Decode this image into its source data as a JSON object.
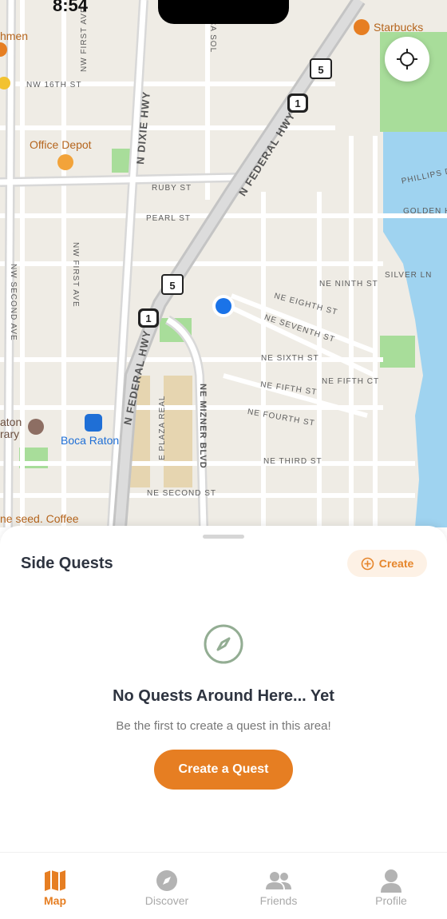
{
  "status": {
    "time": "8:54"
  },
  "map": {
    "pois": [
      {
        "name": "Starbucks"
      },
      {
        "name": "Office Depot"
      },
      {
        "name": "Boca Raton"
      },
      {
        "name": "ne seed. Coffee"
      },
      {
        "name": "hmen"
      },
      {
        "name": "aton"
      },
      {
        "name": "rary"
      }
    ],
    "streets": [
      "NW 16TH ST",
      "NW FIRST AVE",
      "N DIXIE HWY",
      "RUBY ST",
      "PEARL ST",
      "NW SECOND AVE",
      "NW FIRST AVE",
      "N FEDERAL HWY",
      "N FEDERAL HWY",
      "NE EIGHTH ST",
      "NE SEVENTH ST",
      "NE SIXTH ST",
      "NE FIFTH ST",
      "NE FIFTH CT",
      "NE FOURTH ST",
      "NE THIRD ST",
      "NE SECOND ST",
      "E PLAZA REAL",
      "NE MIZNER BLVD",
      "NE NINTH ST",
      "PHILLIPS D",
      "GOLDEN H",
      "SILVER LN",
      "CA SOL"
    ],
    "shields": [
      "5",
      "1",
      "5",
      "1"
    ],
    "colors": {
      "land": "#efece5",
      "park": "#a8dd9a",
      "water": "#9fd3f0",
      "road": "#ffffff",
      "highway": "#c9c9c9",
      "user_dot": "#1a73e8"
    }
  },
  "sheet": {
    "title": "Side Quests",
    "create_label": "Create",
    "empty_title": "No Quests Around Here... Yet",
    "empty_subtitle": "Be the first to create a quest in this area!",
    "cta_label": "Create a Quest",
    "accent": "#e67e22"
  },
  "tabs": [
    {
      "label": "Map",
      "icon": "map-icon",
      "active": true
    },
    {
      "label": "Discover",
      "icon": "compass-icon",
      "active": false
    },
    {
      "label": "Friends",
      "icon": "friends-icon",
      "active": false
    },
    {
      "label": "Profile",
      "icon": "profile-icon",
      "active": false
    }
  ]
}
